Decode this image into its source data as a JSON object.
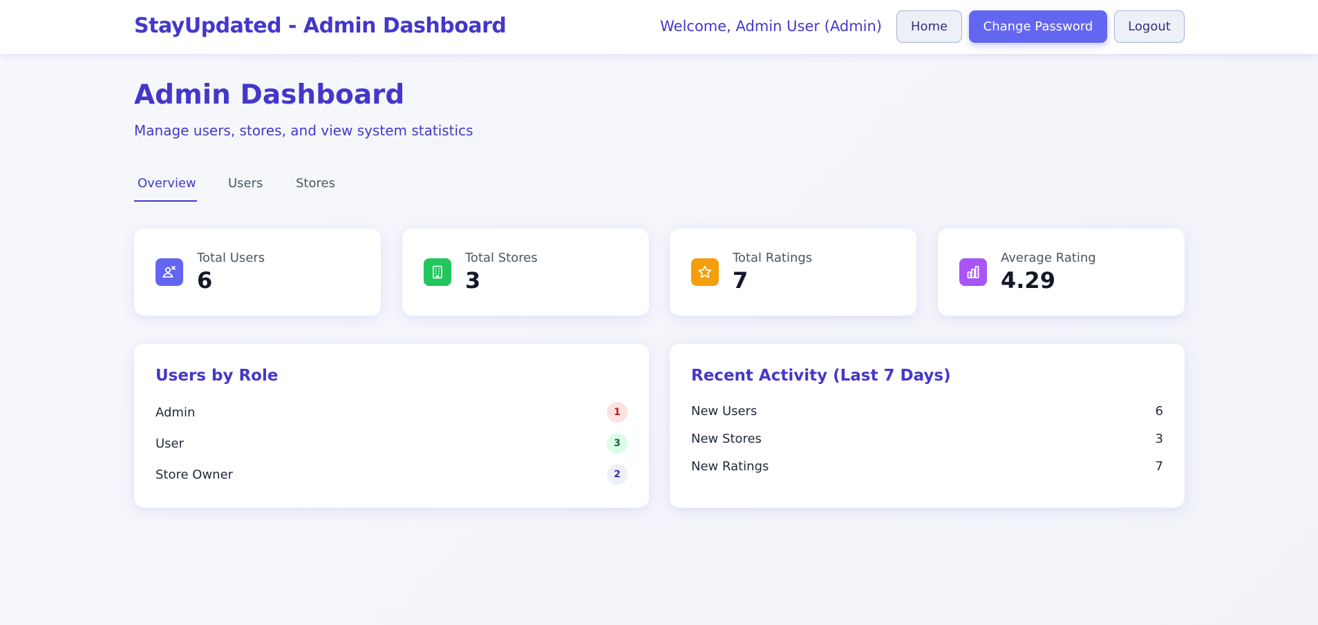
{
  "header": {
    "brand": "StayUpdated - Admin Dashboard",
    "welcome": "Welcome, Admin User (Admin)",
    "home_label": "Home",
    "change_password_label": "Change Password",
    "logout_label": "Logout"
  },
  "page": {
    "title": "Admin Dashboard",
    "subtitle": "Manage users, stores, and view system statistics"
  },
  "tabs": [
    {
      "label": "Overview",
      "active": true
    },
    {
      "label": "Users",
      "active": false
    },
    {
      "label": "Stores",
      "active": false
    }
  ],
  "stats": [
    {
      "label": "Total Users",
      "value": "6",
      "icon": "users-icon",
      "color": "#6366f1"
    },
    {
      "label": "Total Stores",
      "value": "3",
      "icon": "building-icon",
      "color": "#22c55e"
    },
    {
      "label": "Total Ratings",
      "value": "7",
      "icon": "star-icon",
      "color": "#f59e0b"
    },
    {
      "label": "Average Rating",
      "value": "4.29",
      "icon": "bar-chart-icon",
      "color": "#a855f7"
    }
  ],
  "users_by_role": {
    "title": "Users by Role",
    "items": [
      {
        "label": "Admin",
        "count": "1",
        "bg": "#fde2e2",
        "fg": "#b91c1c"
      },
      {
        "label": "User",
        "count": "3",
        "bg": "#dcfce7",
        "fg": "#166534"
      },
      {
        "label": "Store Owner",
        "count": "2",
        "bg": "#eef0f7",
        "fg": "#3730a3"
      }
    ]
  },
  "recent_activity": {
    "title": "Recent Activity (Last 7 Days)",
    "items": [
      {
        "label": "New Users",
        "value": "6"
      },
      {
        "label": "New Stores",
        "value": "3"
      },
      {
        "label": "New Ratings",
        "value": "7"
      }
    ]
  }
}
